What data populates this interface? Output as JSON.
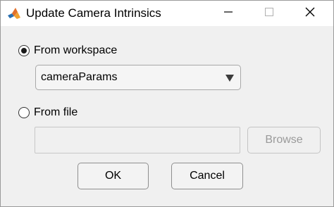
{
  "window": {
    "title": "Update Camera Intrinsics",
    "app_icon": "matlab-icon"
  },
  "options": {
    "workspace": {
      "label": "From workspace",
      "selected": true,
      "dropdown_value": "cameraParams"
    },
    "file": {
      "label": "From file",
      "selected": false,
      "path_value": "",
      "browse_label": "Browse",
      "browse_enabled": false
    }
  },
  "buttons": {
    "ok_label": "OK",
    "cancel_label": "Cancel"
  },
  "colors": {
    "background": "#f0f0f0",
    "titlebar": "#ffffff",
    "disabled_text": "#9a9a9a"
  }
}
